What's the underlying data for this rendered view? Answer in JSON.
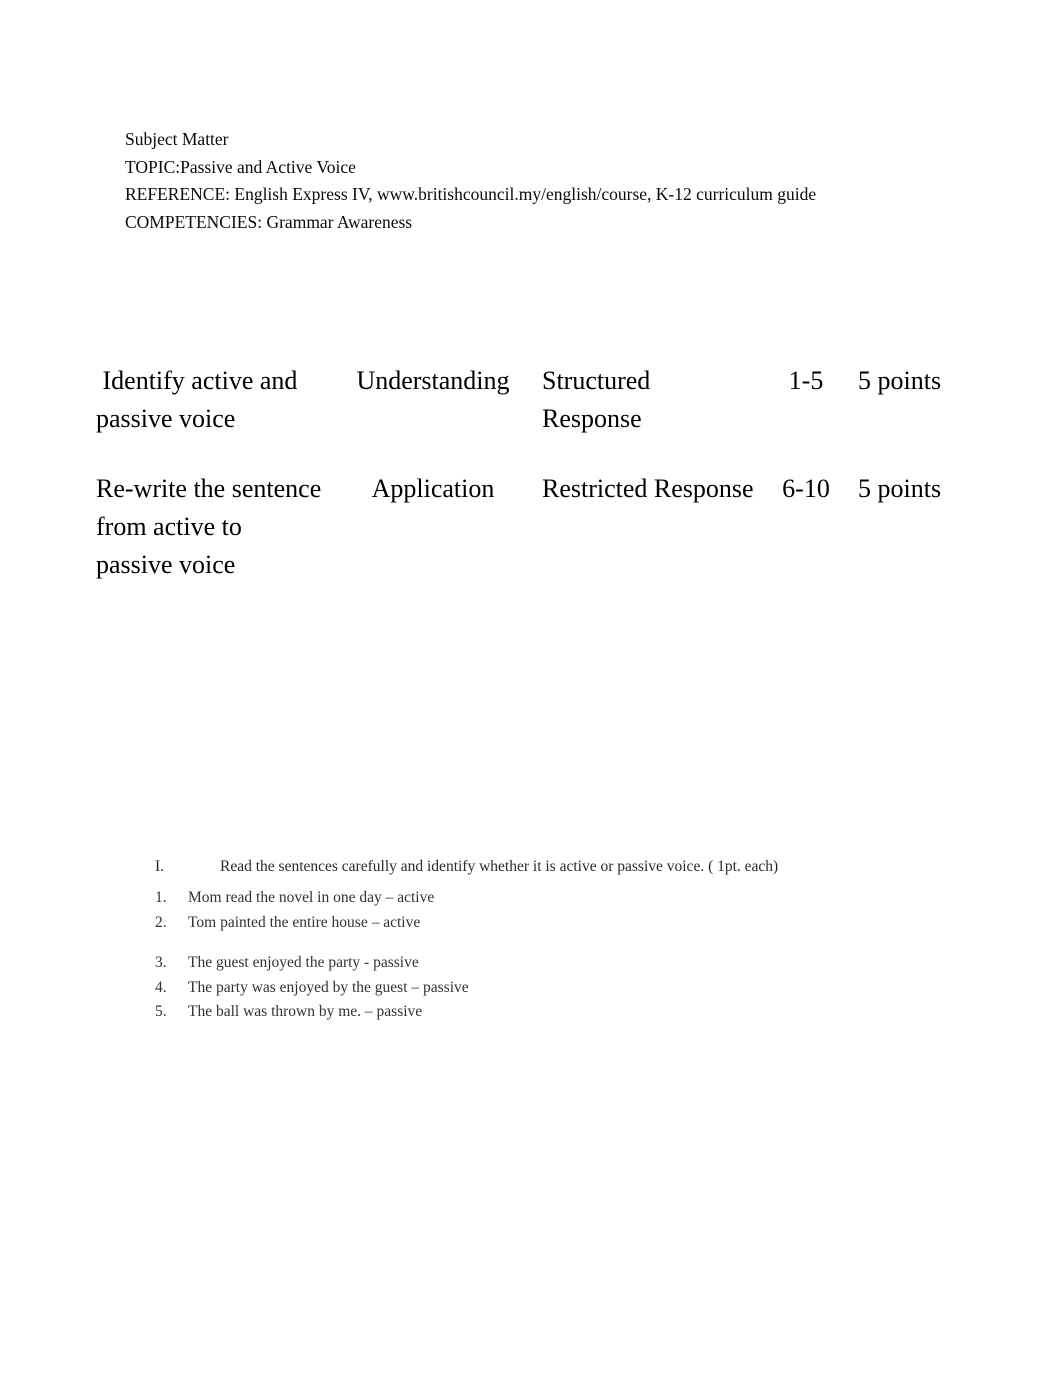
{
  "document": {
    "background_color": "#ffffff",
    "text_color": "#000000",
    "secondary_text_color": "#333333"
  },
  "header": {
    "lines": [
      "Subject Matter",
      "TOPIC:Passive and Active Voice",
      "REFERENCE: English Express IV, www.britishcouncil.my/english/course, K-12 curriculum guide",
      "COMPETENCIES: Grammar Awareness"
    ]
  },
  "table_of_specification": {
    "rows": [
      {
        "objective": " Identify active and passive voice",
        "level": "Understanding",
        "response_type": "Structured Response",
        "item_numbers": "1-5",
        "points": "5 points"
      },
      {
        "objective": "Re-write the sentence from active to passive voice",
        "level": "Application",
        "response_type": "Restricted Response",
        "item_numbers": "6-10",
        "points": "5 points"
      }
    ]
  },
  "activity": {
    "instruction": {
      "marker": "I.",
      "text": "Read the sentences carefully and identify whether it is active or passive voice. ( 1pt. each)"
    },
    "questions": [
      {
        "marker": "1.",
        "text": "Mom read the novel in one day – active"
      },
      {
        "marker": "2.",
        "text": "Tom painted the entire house – active"
      },
      {
        "marker": "3.",
        "text": "The guest enjoyed the party - passive"
      },
      {
        "marker": "4.",
        "text": "The party was enjoyed by the guest – passive"
      },
      {
        "marker": "5.",
        "text": "The ball was thrown by me. – passive"
      }
    ]
  }
}
